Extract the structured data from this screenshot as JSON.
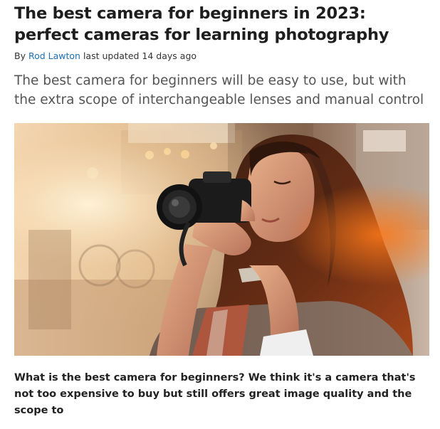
{
  "article": {
    "title": "The best camera for beginners in 2023: perfect cameras for learning photography",
    "byline": {
      "prefix": "By",
      "author": "Rod Lawton",
      "updated": "last updated 14 days ago"
    },
    "standfirst": "The best camera for beginners will be easy to use, but with the extra scope of interchangeable lenses and manual control",
    "hero_image": {
      "subject": "young woman with long dark hair holding a black DSLR camera up to her eye, sunlit city street background"
    },
    "body": "What is the best camera for beginners? We think it's a camera that's not too expensive to buy but still offers great image quality and the scope to"
  },
  "colors": {
    "title": "#1e1e1e",
    "author_link": "#1a6fb5",
    "standfirst": "#555555",
    "body": "#222222"
  }
}
